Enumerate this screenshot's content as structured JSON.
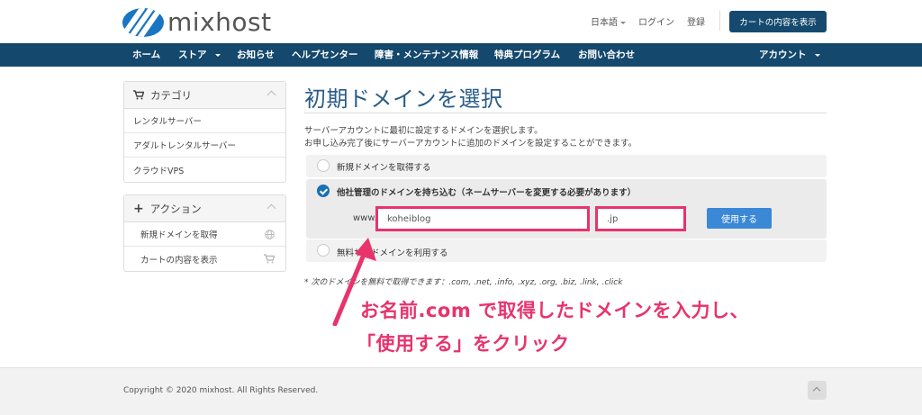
{
  "header": {
    "logo_text": "mixhost",
    "language": "日本語",
    "login": "ログイン",
    "register": "登録",
    "cart_button": "カートの内容を表示"
  },
  "nav": {
    "items": [
      "ホーム",
      "ストア",
      "お知らせ",
      "ヘルプセンター",
      "障害・メンテナンス情報",
      "特典プログラム",
      "お問い合わせ"
    ],
    "account": "アカウント"
  },
  "sidebar": {
    "category": {
      "title": "カテゴリ",
      "items": [
        "レンタルサーバー",
        "アダルトレンタルサーバー",
        "クラウドVPS"
      ]
    },
    "actions": {
      "title": "アクション",
      "items": [
        "新規ドメインを取得",
        "カートの内容を表示"
      ]
    }
  },
  "main": {
    "title": "初期ドメインを選択",
    "desc_line1": "サーバーアカウントに最初に設定するドメインを選択します。",
    "desc_line2": "お申し込み完了後にサーバーアカウントに追加のドメインを設定することができます。",
    "options": {
      "register_new": "新規ドメインを取得する",
      "bring_own": "他社管理のドメインを持ち込む（ネームサーバーを変更する必要があります）",
      "subdomain": "無料サブドメインを利用する"
    },
    "domain_form": {
      "prefix": "www.",
      "sld_value": "koheiblog",
      "tld_value": ".jp",
      "use_button": "使用する"
    },
    "note": "* 次のドメインを無料で取得できます：.com, .net, .info, .xyz, .org, .biz, .link, .click",
    "annotation_line1": "お名前.com で取得したドメインを入力し、",
    "annotation_line2": "「使用する」をクリック",
    "accent_color": "#e8336d"
  },
  "footer": {
    "copyright": "Copyright © 2020 mixhost. All Rights Reserved."
  }
}
